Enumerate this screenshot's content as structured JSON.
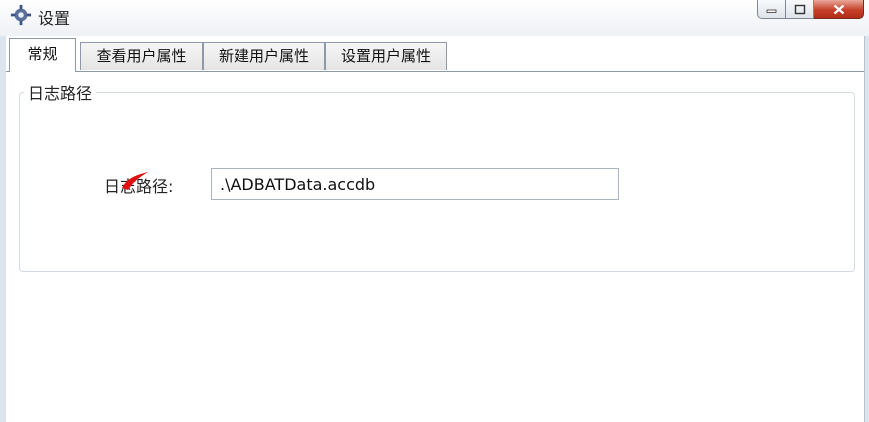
{
  "window": {
    "title": "设置",
    "icon": "gear-icon",
    "controls": [
      "minimize-icon",
      "maximize-icon",
      "close-icon"
    ]
  },
  "tabs": [
    {
      "label": "常规",
      "active": true
    },
    {
      "label": "查看用户属性",
      "active": false
    },
    {
      "label": "新建用户属性",
      "active": false
    },
    {
      "label": "设置用户属性",
      "active": false
    }
  ],
  "general": {
    "group_title": "日志路径",
    "field_label": "日志路径:",
    "path_value": ".\\ADBATData.accdb"
  },
  "colors": {
    "close_button": "#c8402a",
    "annotation_mark": "#e01010"
  }
}
